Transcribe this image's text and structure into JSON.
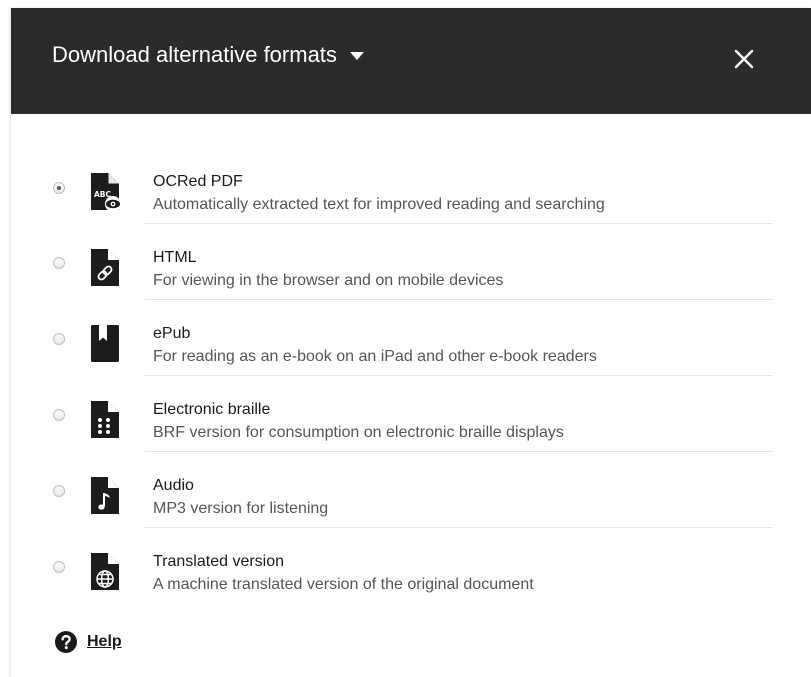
{
  "dialog": {
    "title": "Download alternative formats",
    "close_icon": "close-icon",
    "title_caret_icon": "caret-down-icon"
  },
  "formats": [
    {
      "title": "OCRed PDF",
      "description": "Automatically extracted text for improved reading and searching",
      "icon": "ocr-pdf-icon",
      "badge": "ABC",
      "selected": true
    },
    {
      "title": "HTML",
      "description": "For viewing in the browser and on mobile devices",
      "icon": "html-link-icon",
      "selected": false
    },
    {
      "title": "ePub",
      "description": "For reading as an e-book on an iPad and other e-book readers",
      "icon": "epub-bookmark-icon",
      "selected": false
    },
    {
      "title": "Electronic braille",
      "description": "BRF version for consumption on electronic braille displays",
      "icon": "braille-icon",
      "selected": false
    },
    {
      "title": "Audio",
      "description": "MP3 version for listening",
      "icon": "audio-note-icon",
      "selected": false
    },
    {
      "title": "Translated version",
      "description": "A machine translated version of the original document",
      "icon": "translate-globe-icon",
      "selected": false
    }
  ],
  "help": {
    "label": "Help",
    "icon": "help-icon"
  },
  "colors": {
    "header_bg": "#2b2b2b",
    "text": "#1a1a1a",
    "muted": "#555555"
  }
}
